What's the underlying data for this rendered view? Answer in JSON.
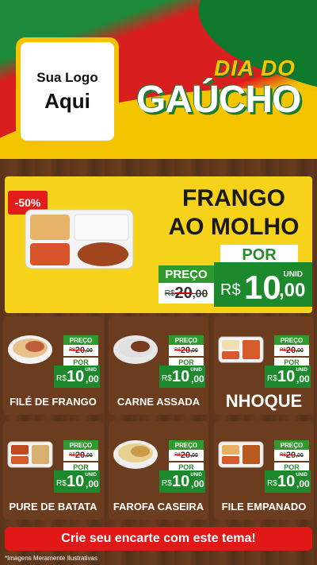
{
  "logo": {
    "line1": "Sua Logo",
    "line2": "Aqui"
  },
  "title": {
    "top": "DIA DO",
    "main": "GAÚCHO"
  },
  "featured": {
    "discount": "-50%",
    "name_line1": "FRANGO",
    "name_line2": "AO MOLHO",
    "preco_label": "PREÇO",
    "old_currency": "R$",
    "old_int": "20",
    "old_dec": ",00",
    "por_label": "POR",
    "unid": "UNID",
    "currency": "R$",
    "price_int": "10",
    "price_dec": ",00"
  },
  "products": [
    {
      "name": "FILÉ DE FRANGO",
      "preco_label": "PREÇO",
      "old_currency": "R$",
      "old_int": "20",
      "old_dec": ",00",
      "por_label": "POR",
      "unid": "UNID",
      "currency": "R$",
      "price_int": "10",
      "price_dec": ",00"
    },
    {
      "name": "CARNE ASSADA",
      "preco_label": "PREÇO",
      "old_currency": "R$",
      "old_int": "20",
      "old_dec": ",00",
      "por_label": "POR",
      "unid": "UNID",
      "currency": "R$",
      "price_int": "10",
      "price_dec": ",00"
    },
    {
      "name": "NHOQUE",
      "preco_label": "PREÇO",
      "old_currency": "R$",
      "old_int": "20",
      "old_dec": ",00",
      "por_label": "POR",
      "unid": "UNID",
      "currency": "R$",
      "price_int": "10",
      "price_dec": ",00"
    },
    {
      "name": "PURE DE BATATA",
      "preco_label": "PREÇO",
      "old_currency": "R$",
      "old_int": "20",
      "old_dec": ",00",
      "por_label": "POR",
      "unid": "UNID",
      "currency": "R$",
      "price_int": "10",
      "price_dec": ",00"
    },
    {
      "name": "FAROFA CASEIRA",
      "preco_label": "PREÇO",
      "old_currency": "R$",
      "old_int": "20",
      "old_dec": ",00",
      "por_label": "POR",
      "unid": "UNID",
      "currency": "R$",
      "price_int": "10",
      "price_dec": ",00"
    },
    {
      "name": "FILE EMPANADO",
      "preco_label": "PREÇO",
      "old_currency": "R$",
      "old_int": "20",
      "old_dec": ",00",
      "por_label": "POR",
      "unid": "UNID",
      "currency": "R$",
      "price_int": "10",
      "price_dec": ",00"
    }
  ],
  "cta": "Crie seu encarte com este tema!",
  "footnote": "*Imagens Meramente Ilustrativas",
  "colors": {
    "green": "#1c8a2c",
    "red": "#e01818",
    "yellow": "#f7d21a",
    "wood": "#6b3d1e"
  }
}
